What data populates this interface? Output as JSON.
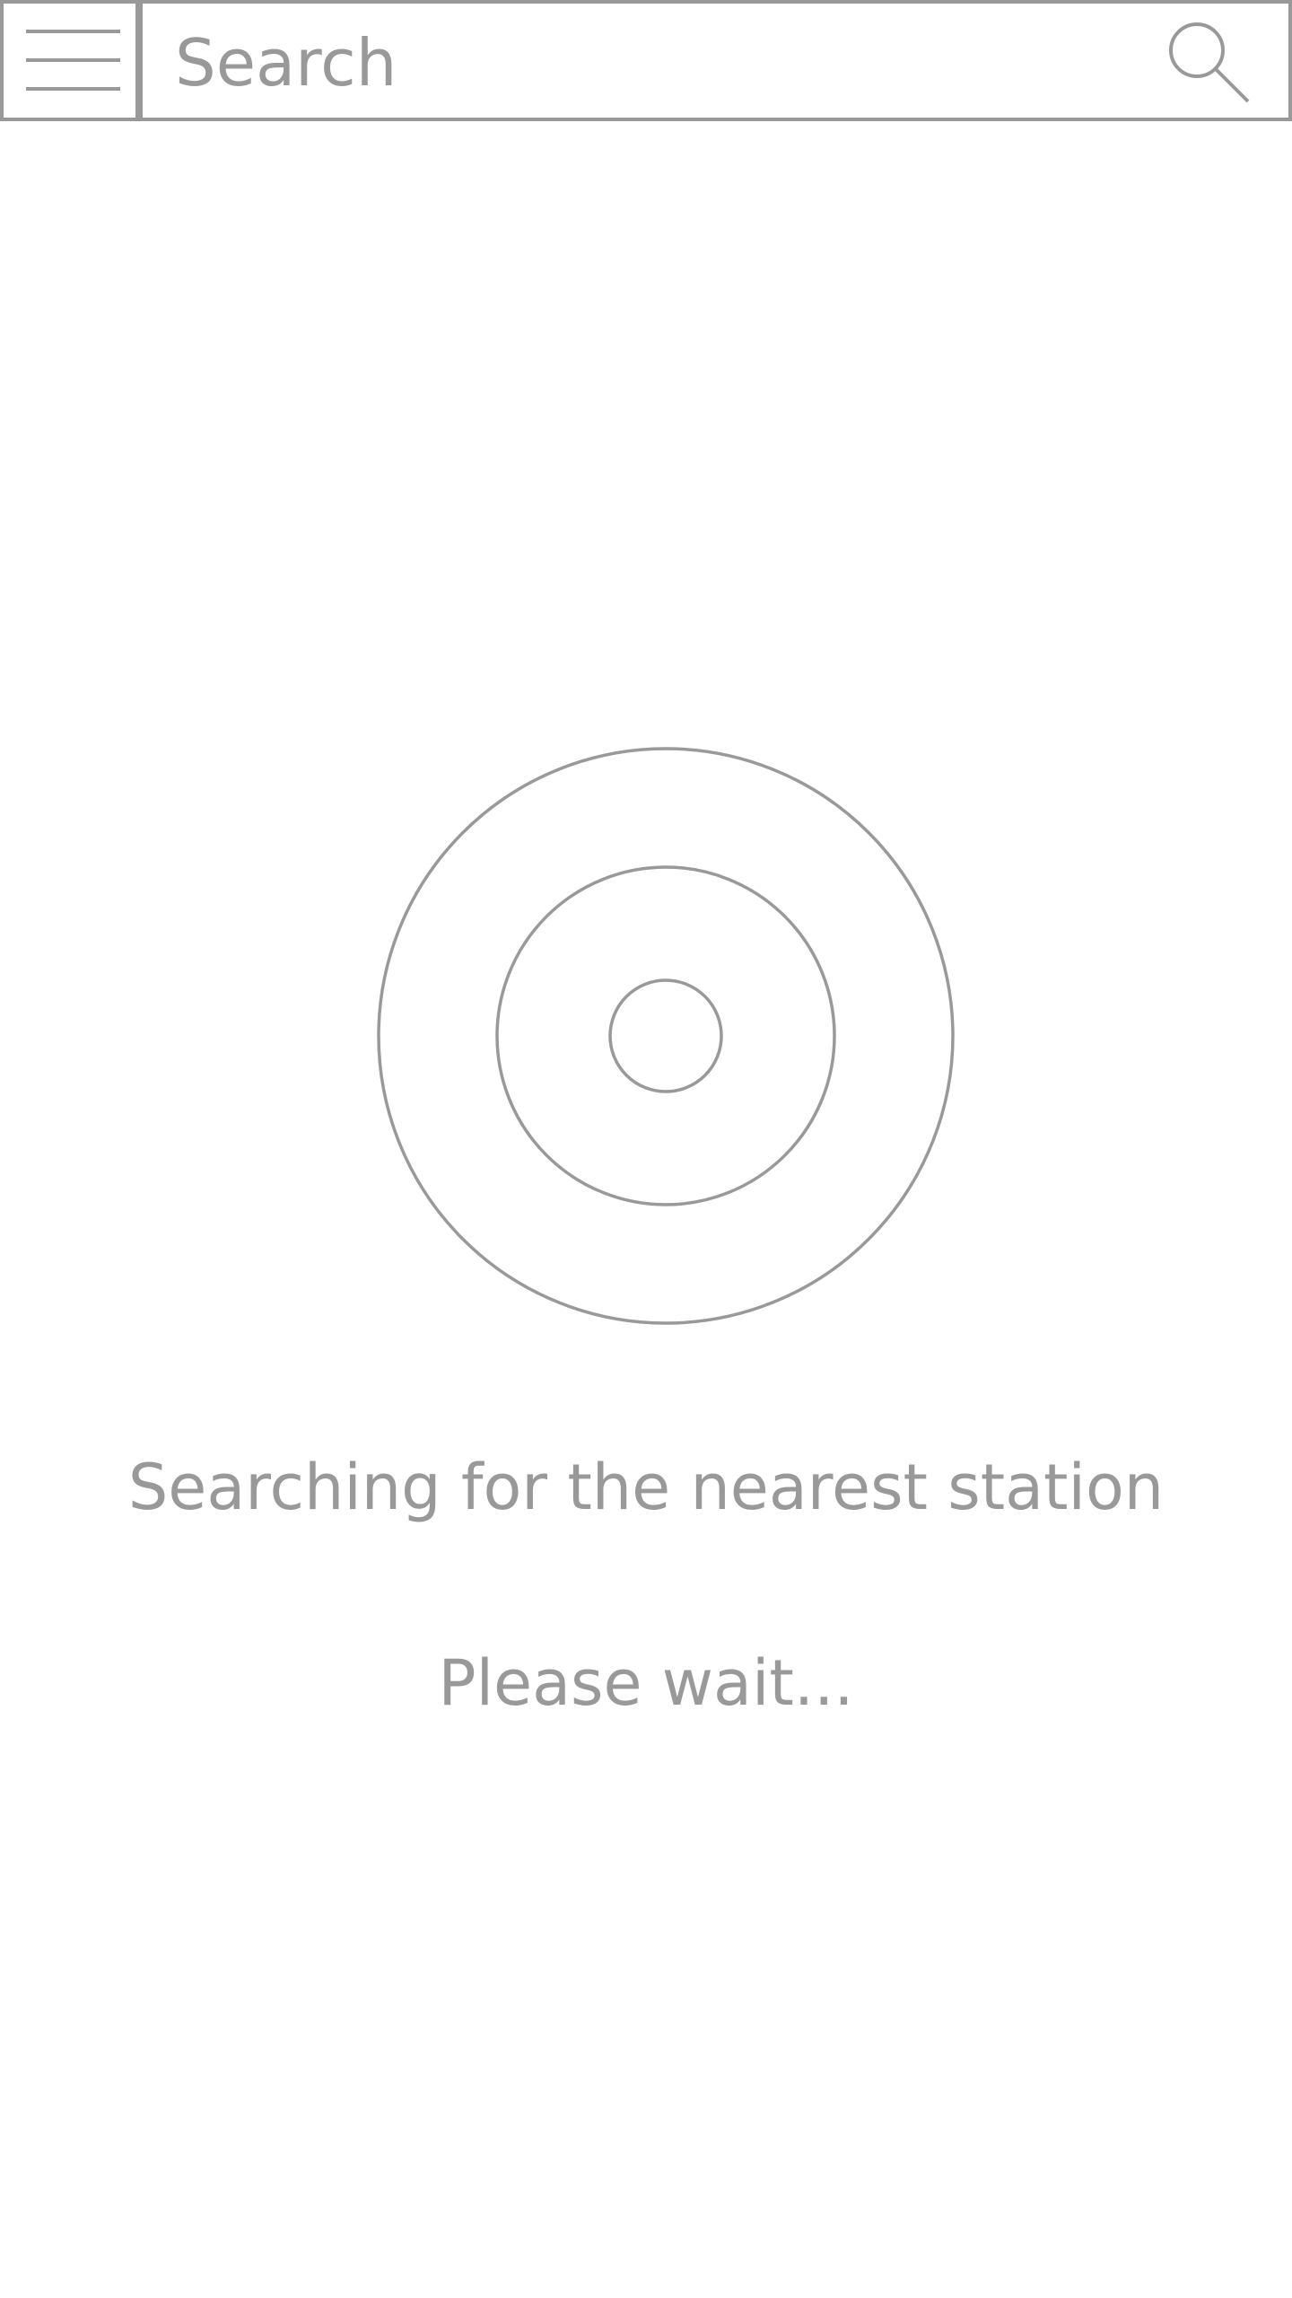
{
  "header": {
    "menu_icon": "hamburger-menu-icon",
    "search": {
      "placeholder": "Search",
      "value": "",
      "icon": "search-icon"
    }
  },
  "main": {
    "indicator_icon": "radar-target-icon",
    "title": "Searching for the nearest station",
    "subtitle": "Please wait..."
  },
  "colors": {
    "stroke": "#999999",
    "text": "#999999",
    "background": "#ffffff"
  }
}
